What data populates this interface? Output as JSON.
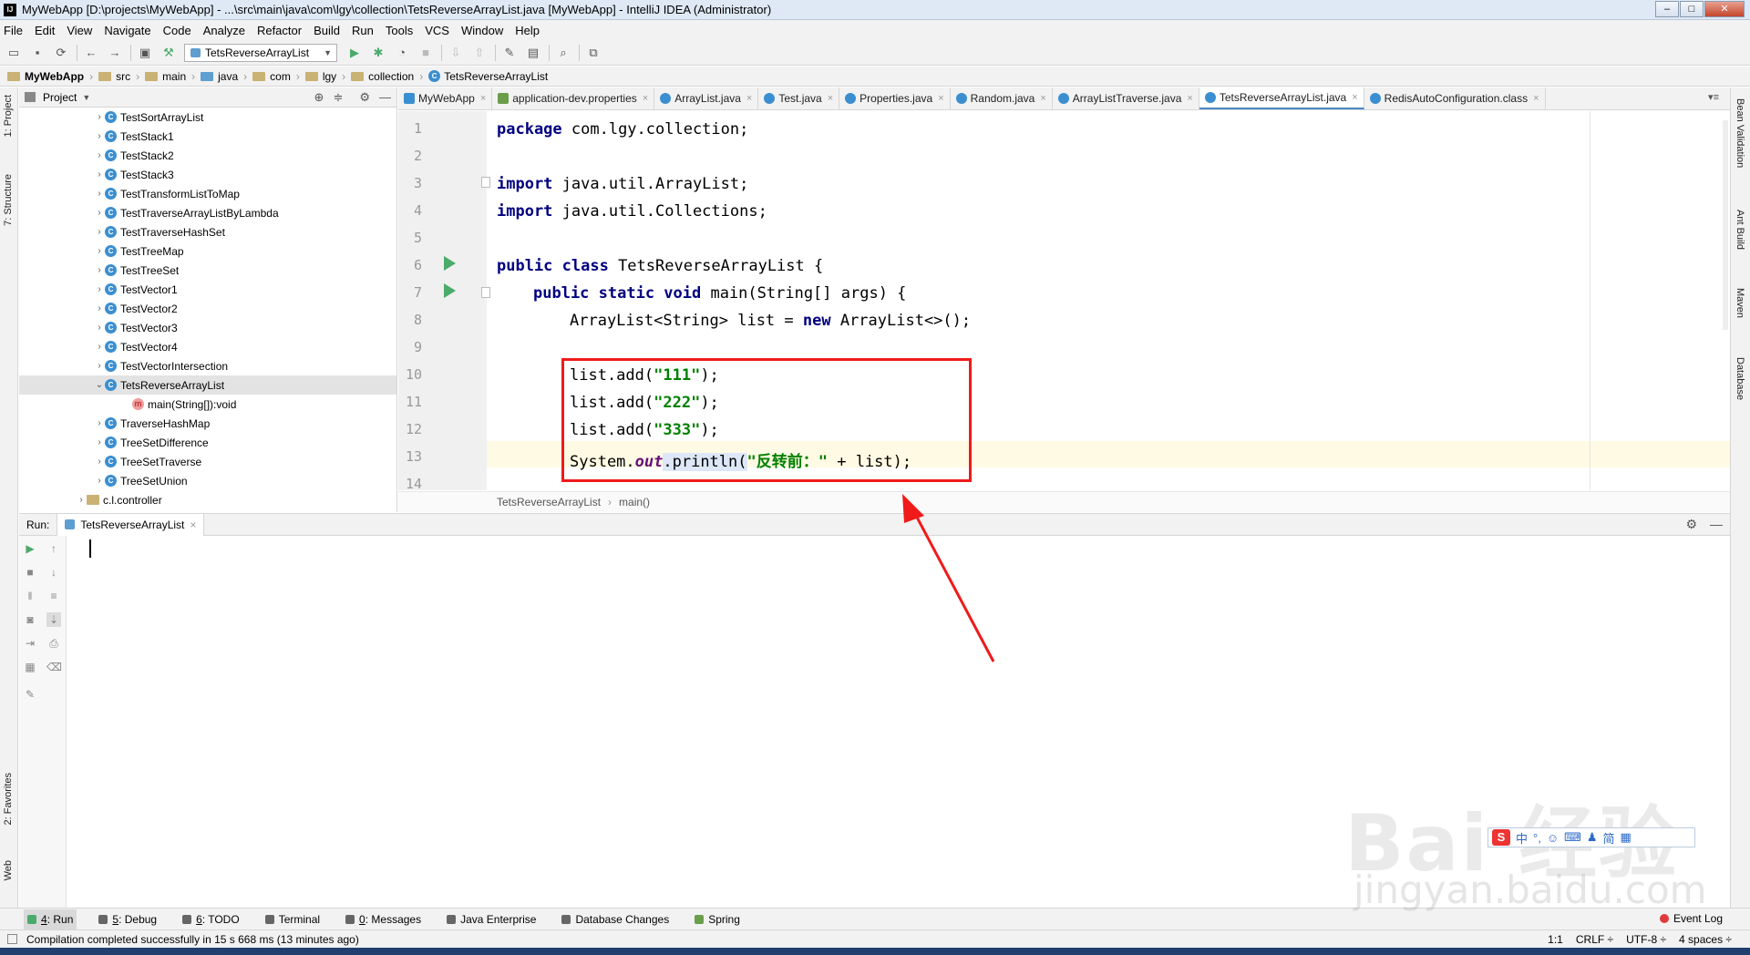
{
  "window": {
    "title": "MyWebApp [D:\\projects\\MyWebApp] - ...\\src\\main\\java\\com\\lgy\\collection\\TetsReverseArrayList.java [MyWebApp] - IntelliJ IDEA (Administrator)",
    "app_icon": "IJ"
  },
  "menu": [
    "File",
    "Edit",
    "View",
    "Navigate",
    "Code",
    "Analyze",
    "Refactor",
    "Build",
    "Run",
    "Tools",
    "VCS",
    "Window",
    "Help"
  ],
  "toolbar": {
    "run_config": "TetsReverseArrayList"
  },
  "breadcrumb": [
    "MyWebApp",
    "src",
    "main",
    "java",
    "com",
    "lgy",
    "collection",
    "TetsReverseArrayList"
  ],
  "left_stripe": {
    "project": "1: Project",
    "structure": "7: Structure",
    "favorites": "2: Favorites",
    "web": "Web"
  },
  "right_stripe": {
    "bean": "Bean Validation",
    "ant": "Ant Build",
    "maven": "Maven",
    "database": "Database"
  },
  "project": {
    "header": "Project",
    "items": [
      {
        "label": "TestSortArrayList",
        "type": "class",
        "arrow": "›"
      },
      {
        "label": "TestStack1",
        "type": "class",
        "arrow": "›"
      },
      {
        "label": "TestStack2",
        "type": "class",
        "arrow": "›"
      },
      {
        "label": "TestStack3",
        "type": "class",
        "arrow": "›"
      },
      {
        "label": "TestTransformListToMap",
        "type": "class",
        "arrow": "›"
      },
      {
        "label": "TestTraverseArrayListByLambda",
        "type": "class",
        "arrow": "›"
      },
      {
        "label": "TestTraverseHashSet",
        "type": "class",
        "arrow": "›"
      },
      {
        "label": "TestTreeMap",
        "type": "class",
        "arrow": "›"
      },
      {
        "label": "TestTreeSet",
        "type": "class",
        "arrow": "›"
      },
      {
        "label": "TestVector1",
        "type": "class",
        "arrow": "›"
      },
      {
        "label": "TestVector2",
        "type": "class",
        "arrow": "›"
      },
      {
        "label": "TestVector3",
        "type": "class",
        "arrow": "›"
      },
      {
        "label": "TestVector4",
        "type": "class",
        "arrow": "›"
      },
      {
        "label": "TestVectorIntersection",
        "type": "class",
        "arrow": "›"
      },
      {
        "label": "TetsReverseArrayList",
        "type": "class",
        "arrow": "⌄"
      },
      {
        "label": "main(String[]):void",
        "type": "method",
        "arrow": ""
      },
      {
        "label": "TraverseHashMap",
        "type": "class",
        "arrow": "›"
      },
      {
        "label": "TreeSetDifference",
        "type": "class",
        "arrow": "›"
      },
      {
        "label": "TreeSetTraverse",
        "type": "class",
        "arrow": "›"
      },
      {
        "label": "TreeSetUnion",
        "type": "class",
        "arrow": "›"
      },
      {
        "label": "c.l.controller",
        "type": "folder",
        "arrow": "›"
      }
    ]
  },
  "tabs": [
    "MyWebApp",
    "application-dev.properties",
    "ArrayList.java",
    "Test.java",
    "Properties.java",
    "Random.java",
    "ArrayListTraverse.java",
    "TetsReverseArrayList.java",
    "RedisAutoConfiguration.class"
  ],
  "active_tab": "TetsReverseArrayList.java",
  "editor": {
    "line_numbers": [
      "1",
      "2",
      "3",
      "4",
      "5",
      "6",
      "7",
      "8",
      "9",
      "10",
      "11",
      "12",
      "13",
      "14"
    ],
    "lines": {
      "l1_kw": "package",
      "l1_rest": " com.lgy.collection;",
      "l3_kw": "import",
      "l3_rest": " java.util.ArrayList;",
      "l4_kw": "import",
      "l4_rest": " java.util.Collections;",
      "l6_kw": "public class",
      "l6_rest": " TetsReverseArrayList {",
      "l7_kw": "public static void",
      "l7_rest": " main(String[] args) {",
      "l8_a": "ArrayList<String> list = ",
      "l8_kw": "new",
      "l8_b": " ArrayList<>();",
      "l10_a": "list.add(",
      "l10_s": "\"111\"",
      "l10_b": ");",
      "l11_a": "list.add(",
      "l11_s": "\"222\"",
      "l11_b": ");",
      "l12_a": "list.add(",
      "l12_s": "\"333\"",
      "l12_b": ");",
      "l13_a": "System.",
      "l13_out": "out",
      "l13_b": ".println(",
      "l13_s": "\"反转前：\"",
      "l13_c": " + list);"
    },
    "bottom_crumb": [
      "TetsReverseArrayList",
      "main()"
    ]
  },
  "run_panel": {
    "label": "Run:",
    "tab": "TetsReverseArrayList"
  },
  "bottom_tools": [
    {
      "num": "4",
      "label": ": Run"
    },
    {
      "num": "5",
      "label": ": Debug"
    },
    {
      "num": "6",
      "label": ": TODO"
    },
    {
      "num": "",
      "label": "Terminal"
    },
    {
      "num": "0",
      "label": ": Messages"
    },
    {
      "num": "",
      "label": "Java Enterprise"
    },
    {
      "num": "",
      "label": "Database Changes"
    },
    {
      "num": "",
      "label": "Spring"
    }
  ],
  "event_log": "Event Log",
  "status": {
    "message": "Compilation completed successfully in 15 s 668 ms (13 minutes ago)",
    "position": "1:1",
    "line_sep": "CRLF ÷",
    "encoding": "UTF-8 ÷",
    "indent": "4 spaces ÷"
  },
  "watermark": {
    "main": "Bai 经验",
    "sub": "jingyan.baidu.com"
  },
  "ime": {
    "logo": "S",
    "lang": "简"
  },
  "colors": {
    "accent": "#4a88c7",
    "keyword": "#000080",
    "string": "#008000",
    "annotation_box": "#f01a1a"
  }
}
